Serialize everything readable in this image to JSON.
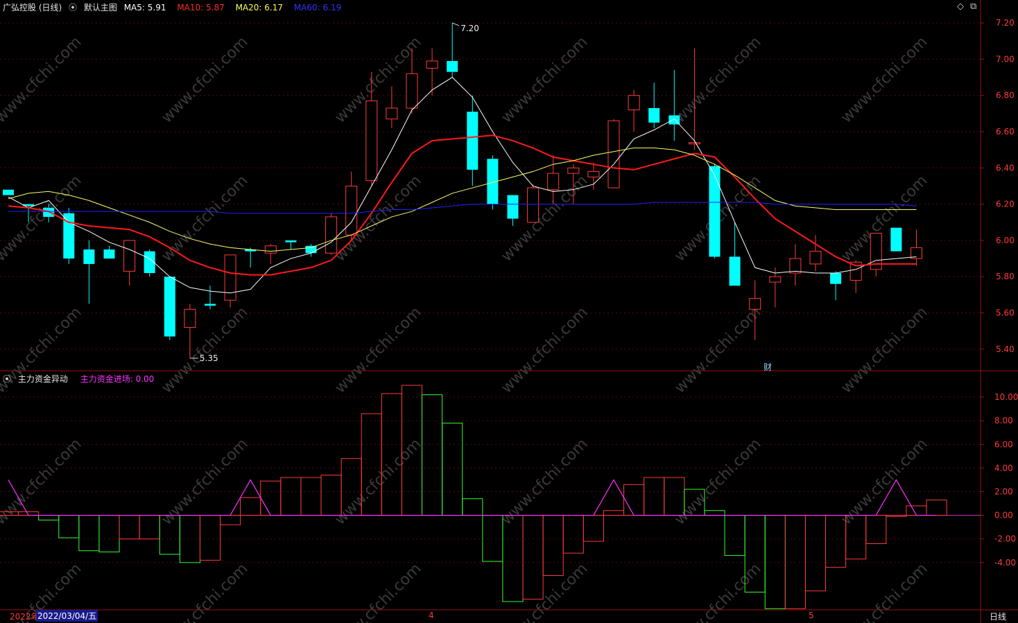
{
  "header": {
    "stock": "广弘控股 (日线)",
    "chart_name": "默认主图",
    "ma5_label": "MA5:",
    "ma5_value": "5.91",
    "ma10_label": "MA10:",
    "ma10_value": "5.87",
    "ma20_label": "MA20:",
    "ma20_value": "6.17",
    "ma60_label": "MA60:",
    "ma60_value": "6.19"
  },
  "sub_header": {
    "indicator": "主力资金异动",
    "label": "主力资金进场:",
    "value": "0.00"
  },
  "annotations": {
    "high": "7.20",
    "low": "5.35",
    "event": "财"
  },
  "x_axis": {
    "year": "2022年",
    "date": "2022/03/04/五",
    "month4": "4",
    "month5": "5",
    "period": "日线"
  },
  "watermark": "www.cfchi.com",
  "colors": {
    "up": "#ff3b3b",
    "down": "#00ffff",
    "ma5": "#ffffff",
    "ma10": "#ff1a1a",
    "ma20": "#ffff66",
    "ma60": "#2222ff",
    "pos": "#ff3b3b",
    "neg": "#33ff33",
    "pink": "#ff33ff"
  },
  "chart_data": [
    {
      "type": "candlestick",
      "title": "广弘控股 (日线)",
      "ylim": [
        5.3,
        7.25
      ],
      "yticks": [
        "5.40",
        "5.60",
        "5.80",
        "6.00",
        "6.20",
        "6.40",
        "6.60",
        "6.80",
        "7.00",
        "7.20"
      ],
      "ohlc": [
        [
          6.28,
          6.28,
          6.25,
          6.25
        ],
        [
          6.2,
          6.2,
          6.1,
          6.19
        ],
        [
          6.18,
          6.2,
          6.1,
          6.13
        ],
        [
          6.15,
          6.18,
          5.87,
          5.9
        ],
        [
          5.95,
          6.0,
          5.65,
          5.87
        ],
        [
          5.95,
          5.97,
          5.9,
          5.9
        ],
        [
          5.83,
          6.0,
          5.75,
          6.0
        ],
        [
          5.94,
          5.95,
          5.8,
          5.82
        ],
        [
          5.8,
          5.8,
          5.45,
          5.47
        ],
        [
          5.52,
          5.65,
          5.35,
          5.62
        ],
        [
          5.65,
          5.75,
          5.62,
          5.64
        ],
        [
          5.67,
          5.92,
          5.63,
          5.92
        ],
        [
          5.95,
          5.96,
          5.85,
          5.94
        ],
        [
          5.93,
          5.98,
          5.87,
          5.97
        ],
        [
          6.0,
          6.0,
          5.95,
          5.99
        ],
        [
          5.97,
          5.98,
          5.91,
          5.93
        ],
        [
          5.93,
          6.15,
          5.92,
          6.13
        ],
        [
          6.03,
          6.38,
          6.0,
          6.3
        ],
        [
          6.33,
          6.93,
          6.3,
          6.77
        ],
        [
          6.67,
          6.85,
          6.62,
          6.73
        ],
        [
          6.73,
          7.06,
          6.7,
          6.92
        ],
        [
          6.95,
          7.06,
          6.8,
          6.99
        ],
        [
          6.99,
          7.2,
          6.9,
          6.93
        ],
        [
          6.71,
          6.8,
          6.3,
          6.39
        ],
        [
          6.45,
          6.47,
          6.17,
          6.2
        ],
        [
          6.25,
          6.25,
          6.08,
          6.12
        ],
        [
          6.1,
          6.31,
          6.1,
          6.29
        ],
        [
          6.28,
          6.47,
          6.2,
          6.37
        ],
        [
          6.37,
          6.42,
          6.2,
          6.4
        ],
        [
          6.35,
          6.43,
          6.28,
          6.38
        ],
        [
          6.29,
          6.67,
          6.29,
          6.66
        ],
        [
          6.72,
          6.83,
          6.6,
          6.8
        ],
        [
          6.73,
          6.87,
          6.62,
          6.65
        ],
        [
          6.69,
          6.94,
          6.55,
          6.64
        ],
        [
          6.54,
          7.06,
          6.5,
          6.54
        ],
        [
          6.41,
          6.42,
          5.9,
          5.91
        ],
        [
          5.91,
          6.1,
          5.8,
          5.75
        ],
        [
          5.62,
          5.78,
          5.45,
          5.68
        ],
        [
          5.77,
          5.85,
          5.63,
          5.8
        ],
        [
          5.82,
          5.98,
          5.75,
          5.9
        ],
        [
          5.87,
          6.03,
          5.83,
          5.94
        ],
        [
          5.82,
          5.83,
          5.67,
          5.76
        ],
        [
          5.78,
          5.89,
          5.71,
          5.88
        ],
        [
          5.84,
          6.04,
          5.8,
          6.04
        ],
        [
          6.07,
          6.07,
          5.94,
          5.94
        ],
        [
          5.9,
          6.06,
          5.86,
          5.96
        ]
      ],
      "series": [
        {
          "name": "MA5",
          "values": [
            6.24,
            6.18,
            6.22,
            6.1,
            6.05,
            5.99,
            5.95,
            5.9,
            5.8,
            5.74,
            5.72,
            5.71,
            5.73,
            5.85,
            5.9,
            5.93,
            5.99,
            6.1,
            6.3,
            6.5,
            6.72,
            6.83,
            6.9,
            6.79,
            6.6,
            6.43,
            6.3,
            6.27,
            6.28,
            6.31,
            6.42,
            6.56,
            6.61,
            6.67,
            6.55,
            6.36,
            6.1,
            5.85,
            5.82,
            5.83,
            5.82,
            5.82,
            5.84,
            5.89,
            5.9,
            5.91
          ]
        },
        {
          "name": "MA10",
          "values": [
            6.19,
            6.18,
            6.16,
            6.1,
            6.08,
            6.07,
            6.06,
            6.02,
            5.96,
            5.89,
            5.85,
            5.82,
            5.81,
            5.81,
            5.83,
            5.85,
            5.89,
            6.0,
            6.15,
            6.32,
            6.48,
            6.55,
            6.56,
            6.57,
            6.58,
            6.55,
            6.51,
            6.46,
            6.44,
            6.42,
            6.4,
            6.39,
            6.42,
            6.45,
            6.48,
            6.46,
            6.35,
            6.23,
            6.12,
            6.05,
            5.98,
            5.91,
            5.86,
            5.87,
            5.87,
            5.87
          ]
        },
        {
          "name": "MA20",
          "values": [
            6.23,
            6.26,
            6.27,
            6.25,
            6.22,
            6.18,
            6.14,
            6.1,
            6.05,
            6.01,
            5.98,
            5.96,
            5.95,
            5.94,
            5.95,
            5.96,
            6.0,
            6.03,
            6.08,
            6.13,
            6.16,
            6.21,
            6.26,
            6.29,
            6.32,
            6.35,
            6.38,
            6.42,
            6.44,
            6.47,
            6.49,
            6.51,
            6.51,
            6.5,
            6.47,
            6.42,
            6.36,
            6.29,
            6.22,
            6.19,
            6.18,
            6.17,
            6.17,
            6.17,
            6.17,
            6.17
          ]
        },
        {
          "name": "MA60",
          "values": [
            6.16,
            6.16,
            6.16,
            6.16,
            6.16,
            6.16,
            6.16,
            6.16,
            6.16,
            6.16,
            6.16,
            6.15,
            6.15,
            6.15,
            6.15,
            6.15,
            6.15,
            6.15,
            6.16,
            6.17,
            6.17,
            6.18,
            6.19,
            6.2,
            6.2,
            6.2,
            6.2,
            6.2,
            6.2,
            6.2,
            6.2,
            6.2,
            6.21,
            6.21,
            6.21,
            6.21,
            6.21,
            6.21,
            6.2,
            6.2,
            6.2,
            6.2,
            6.2,
            6.2,
            6.2,
            6.19
          ]
        }
      ]
    },
    {
      "type": "bar",
      "title": "主力资金异动",
      "ylim": [
        -8.0,
        11.0
      ],
      "yticks": [
        "10.00",
        "8.00",
        "6.00",
        "4.00",
        "2.00",
        "0.00",
        "-2.00",
        "-4.00"
      ],
      "values": [
        0.3,
        0.3,
        -0.4,
        -1.9,
        -3.0,
        -3.1,
        -2.0,
        -2.0,
        -3.3,
        -4.0,
        -3.8,
        -0.8,
        1.5,
        2.9,
        3.2,
        3.2,
        3.4,
        4.8,
        8.6,
        10.3,
        11.0,
        10.2,
        7.8,
        1.4,
        -3.9,
        -7.3,
        -7.1,
        -5.1,
        -3.2,
        -2.2,
        0.4,
        2.6,
        3.2,
        3.2,
        2.2,
        0.4,
        -3.4,
        -6.5,
        -7.9,
        -7.9,
        -6.4,
        -4.4,
        -3.7,
        -2.4,
        -0.1,
        0.8,
        1.3
      ],
      "series": [
        {
          "name": "主力资金进场",
          "values": [
            3,
            0,
            0,
            0,
            0,
            0,
            0,
            0,
            0,
            0,
            0,
            0,
            3,
            0,
            0,
            0,
            0,
            0,
            0,
            0,
            0,
            0,
            0,
            0,
            0,
            0,
            0,
            0,
            0,
            0,
            3,
            0,
            0,
            0,
            0,
            0,
            0,
            0,
            0,
            0,
            0,
            0,
            0,
            0,
            3,
            0,
            0
          ]
        }
      ]
    }
  ]
}
